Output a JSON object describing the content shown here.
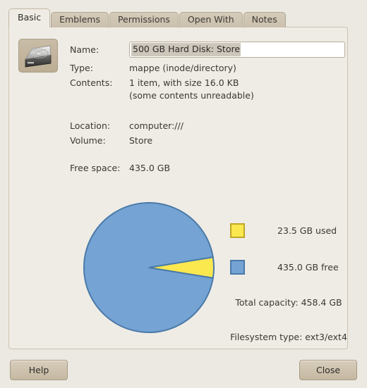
{
  "dialog": {
    "tabs": [
      {
        "label": "Basic",
        "active": true
      },
      {
        "label": "Emblems",
        "active": false
      },
      {
        "label": "Permissions",
        "active": false
      },
      {
        "label": "Open With",
        "active": false
      },
      {
        "label": "Notes",
        "active": false
      }
    ]
  },
  "icon": {
    "name": "hard-disk-icon"
  },
  "fields": {
    "name_label": "Name:",
    "name_value": "500 GB Hard Disk: Store",
    "type_label": "Type:",
    "type_value": "mappe (inode/directory)",
    "contents_label": "Contents:",
    "contents_value_line1": "1 item, with size 16.0 KB",
    "contents_value_line2": "(some contents unreadable)",
    "location_label": "Location:",
    "location_value": "computer:///",
    "volume_label": "Volume:",
    "volume_value": "Store",
    "free_space_label": "Free space:",
    "free_space_value": "435.0 GB"
  },
  "chart_data": {
    "type": "pie",
    "title": "",
    "categories": [
      "23.5 GB used",
      "435.0 GB free"
    ],
    "values": [
      23.5,
      435.0
    ],
    "unit": "GB",
    "total": 458.4,
    "colors": [
      "#fbe84f",
      "#74a3d4"
    ],
    "border_colors": [
      "#bfa727",
      "#4a7aa8"
    ],
    "legend_position": "right",
    "start_angle_deg": -9.2,
    "used_sweep_deg": 18.45,
    "legend": [
      "23.5 GB used",
      "435.0 GB free"
    ],
    "annotations": [
      "Total capacity: 458.4 GB",
      "Filesystem type: ext3/ext4"
    ]
  },
  "chart_text": {
    "legend_used": "23.5 GB used",
    "legend_free": "435.0 GB free",
    "total_capacity": "Total capacity: 458.4 GB",
    "filesystem_type": "Filesystem type: ext3/ext4"
  },
  "buttons": {
    "help": "Help",
    "close": "Close"
  },
  "colors": {
    "used_slice": "#fbe84f",
    "free_slice": "#74a3d4",
    "panel_bg": "#efece6",
    "window_bg": "#ece9e2"
  }
}
